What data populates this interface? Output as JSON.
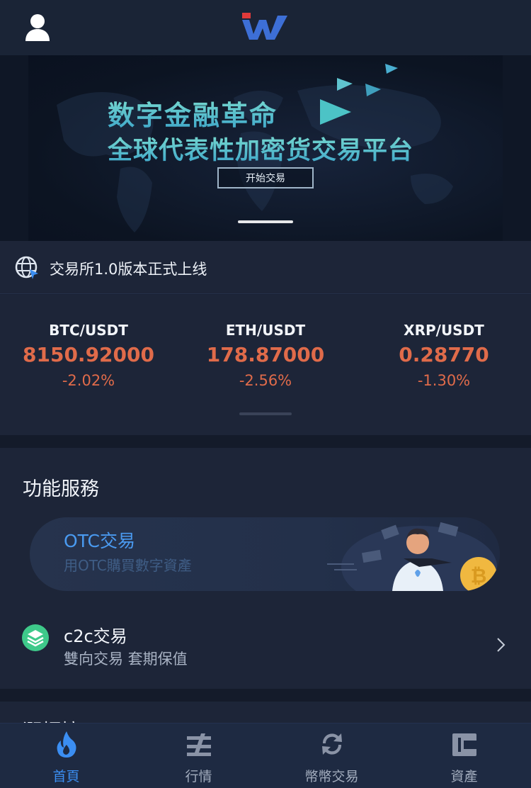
{
  "header": {
    "avatar_icon": "user-icon",
    "logo": "app-logo"
  },
  "banner": {
    "title_line1": "数字金融革命",
    "title_line2": "全球代表性加密货交易平台",
    "cta_label": "开始交易"
  },
  "notice": {
    "icon": "globe-icon",
    "text": "交易所1.0版本正式上线"
  },
  "tickers": [
    {
      "pair": "BTC/USDT",
      "price": "8150.92000",
      "change": "-2.02%"
    },
    {
      "pair": "ETH/USDT",
      "price": "178.87000",
      "change": "-2.56%"
    },
    {
      "pair": "XRP/USDT",
      "price": "0.28770",
      "change": "-1.30%"
    }
  ],
  "services": {
    "title": "功能服務",
    "otc": {
      "title": "OTC交易",
      "subtitle": "用OTC購買數字資產"
    },
    "c2c": {
      "title": "c2c交易",
      "subtitle": "雙向交易 套期保值"
    }
  },
  "next_section": {
    "title": "漲幅榜"
  },
  "tabbar": [
    {
      "label": "首頁",
      "icon": "flame-icon",
      "active": true
    },
    {
      "label": "行情",
      "icon": "chart-icon",
      "active": false
    },
    {
      "label": "幣幣交易",
      "icon": "exchange-icon",
      "active": false
    },
    {
      "label": "資產",
      "icon": "wallet-icon",
      "active": false
    }
  ],
  "colors": {
    "accent": "#3b8ef2",
    "down": "#e06b4a",
    "background": "#1a2234"
  }
}
